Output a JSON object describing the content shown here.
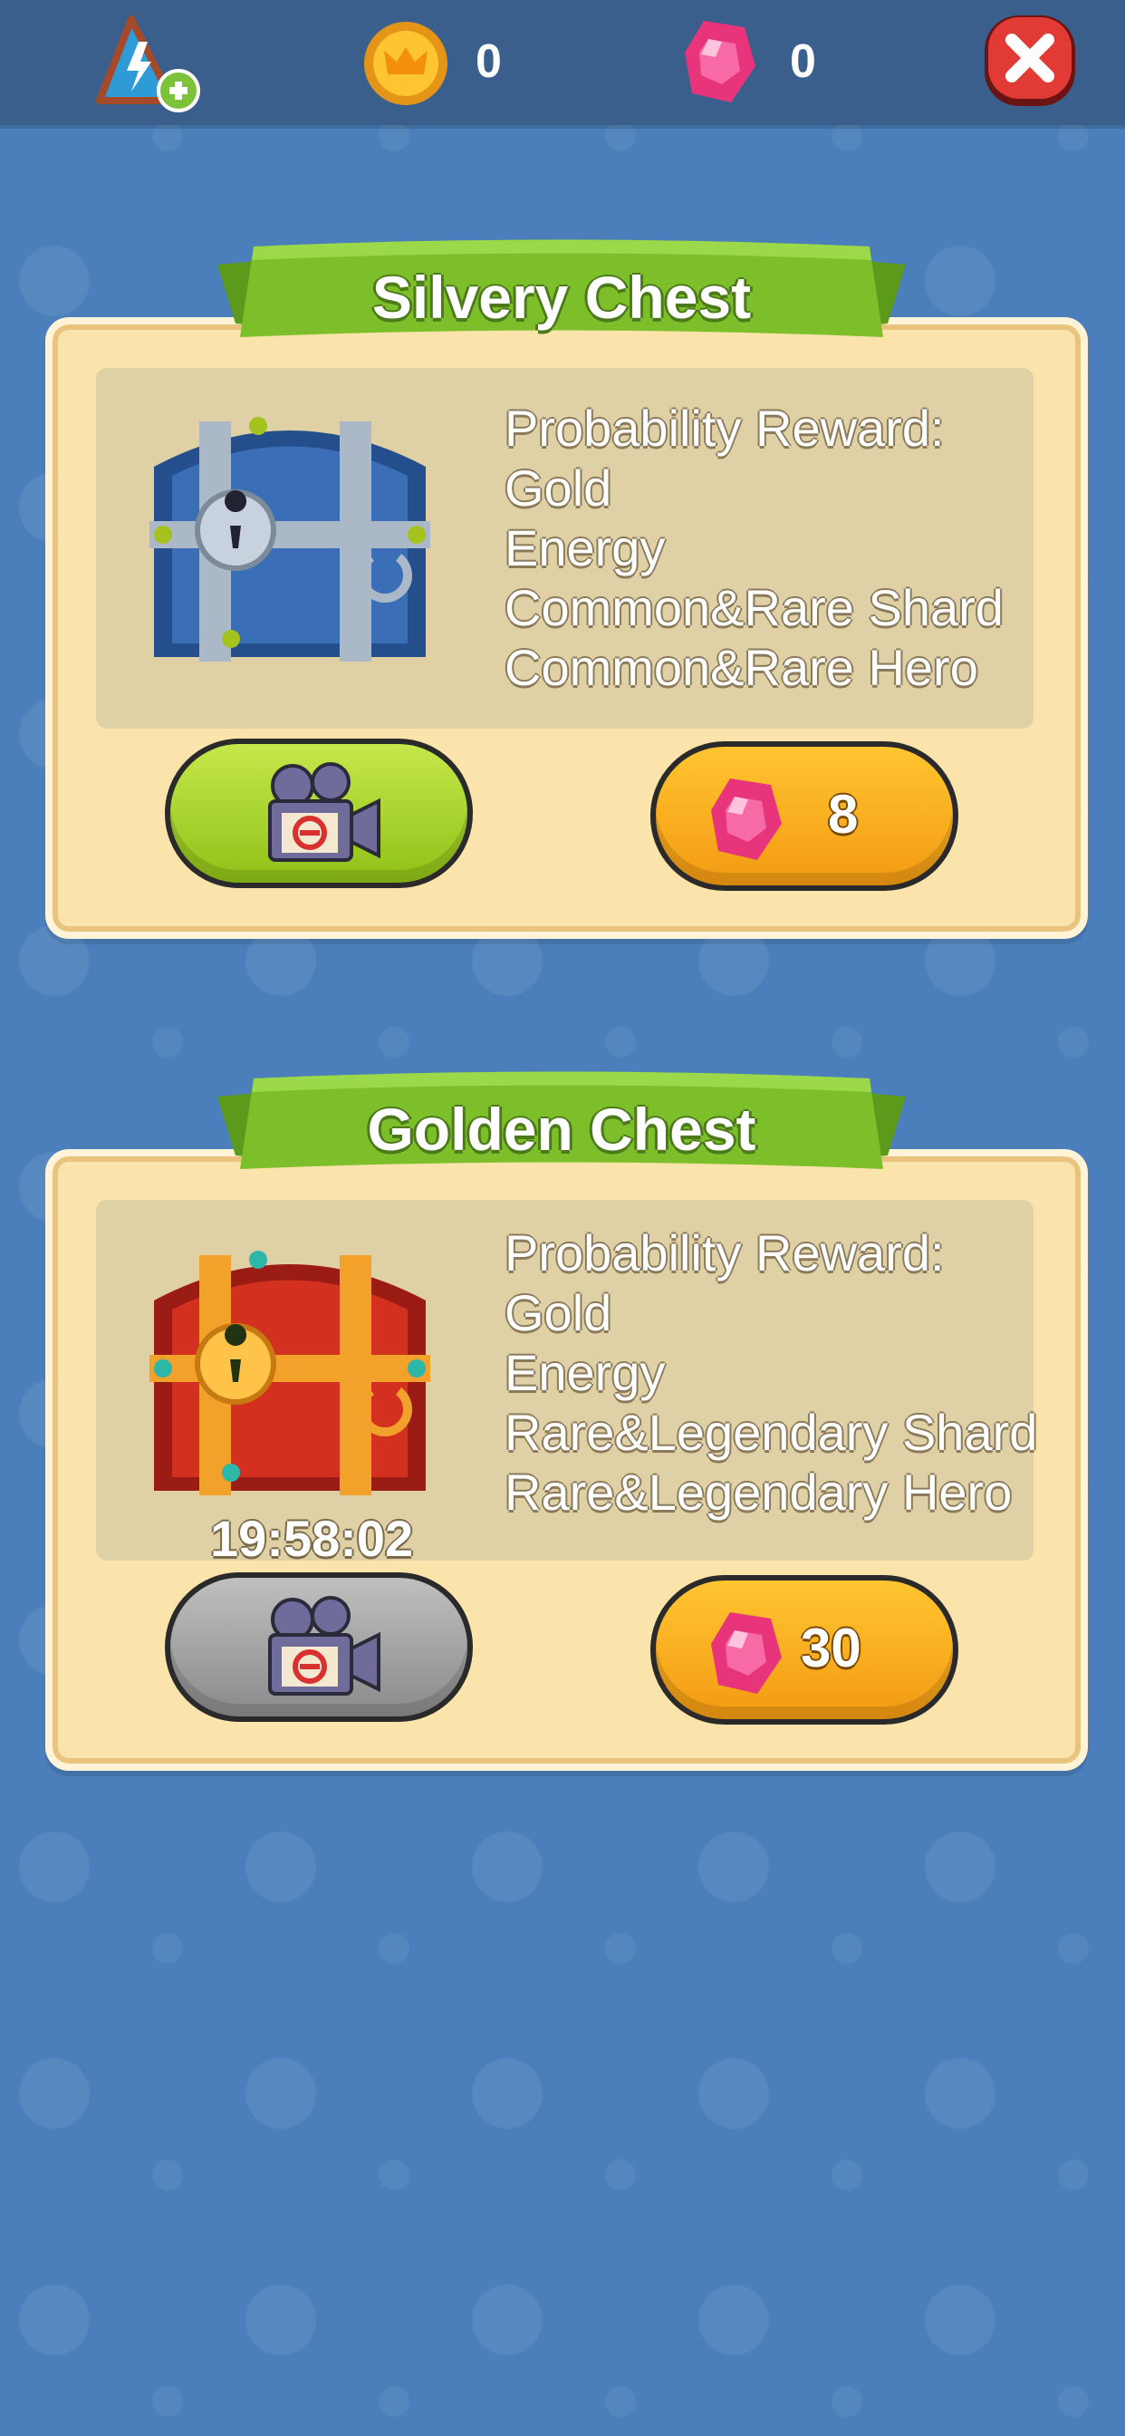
{
  "header": {
    "coin_count": "0",
    "gem_count": "0",
    "icons": [
      "energy-add-icon",
      "coin-icon",
      "gem-icon",
      "close-icon"
    ]
  },
  "chests": [
    {
      "title": "Silvery Chest",
      "reward_heading": "Probability Reward:",
      "rewards": [
        "Gold",
        "Energy",
        "Common&Rare Shard",
        "Common&Rare Hero"
      ],
      "video_button_state": "available",
      "gem_price": "8"
    },
    {
      "title": "Golden Chest",
      "reward_heading": "Probability Reward:",
      "rewards": [
        "Gold",
        "Energy",
        "Rare&Legendary Shard",
        "Rare&Legendary Hero"
      ],
      "timer": "19:58:02",
      "video_button_state": "cooldown",
      "gem_price": "30"
    }
  ],
  "colors": {
    "background": "#4a7fbb",
    "topbar": "#3a5f8d",
    "panel": "#fbe3ac",
    "ribbon": "#7cbf2a",
    "green_button": "#a6d12a",
    "gray_button": "#a0a0a0",
    "orange_button": "#f7ad1c",
    "gem": "#e8347a"
  }
}
